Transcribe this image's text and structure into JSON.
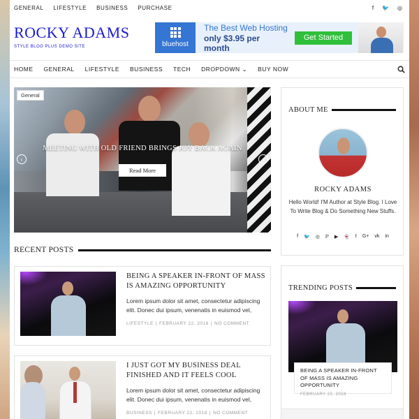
{
  "topbar": {
    "nav": [
      "GENERAL",
      "LIFESTYLE",
      "BUSINESS",
      "PURCHASE"
    ],
    "social_icons": [
      "facebook-icon",
      "twitter-icon",
      "instagram-icon"
    ]
  },
  "header": {
    "title": "ROCKY ADAMS",
    "subtitle": "STYLE BLOG PLUS DEMO SITE"
  },
  "ad": {
    "brand": "bluehost",
    "line1": "The Best Web Hosting",
    "line2": "only $3.95 per month",
    "cta": "Get Started"
  },
  "mainnav": {
    "items": [
      "HOME",
      "GENERAL",
      "LIFESTYLE",
      "BUSINESS",
      "TECH",
      "DROPDOWN",
      "BUY NOW"
    ],
    "dropdown_arrow": "⌄"
  },
  "slider": {
    "category": "General",
    "title": "MEETING WITH OLD FRIEND BRINGS JOY BACK AGAIN",
    "button": "Read More",
    "prev": "‹",
    "next": "›"
  },
  "recent": {
    "heading": "RECENT POSTS",
    "posts": [
      {
        "title": "BEING A SPEAKER IN-FRONT OF MASS IS AMAZING OPPORTUNITY",
        "excerpt": "Lorem ipsum dolor sit amet, consectetur adipiscing elit. Donec dui ipsum, venenatis in euismod vel,",
        "category": "LIFESTYLE",
        "date": "FEBRUARY 22, 2018",
        "comments": "NO COMMENT"
      },
      {
        "title": "I JUST GOT MY BUSINESS DEAL FINISHED AND IT FEELS COOL",
        "excerpt": "Lorem ipsum dolor sit amet, consectetur adipiscing elit. Donec dui ipsum, venenatis in euismod vel,",
        "category": "BUSINESS",
        "date": "FEBRUARY 22, 2018",
        "comments": "NO COMMENT"
      }
    ]
  },
  "about": {
    "heading": "ABOUT ME",
    "name": "ROCKY ADAMS",
    "bio": "Hello World! I'M Author at Style Blog. I Love To Write Blog & Do Something New Stuffs.",
    "social_icons": [
      "facebook-icon",
      "twitter-icon",
      "instagram-icon",
      "pinterest-icon",
      "youtube-icon",
      "snapchat-icon",
      "tumblr-icon",
      "google-plus-icon",
      "vk-icon",
      "linkedin-icon"
    ]
  },
  "trending": {
    "heading": "TRENDING POSTS",
    "title": "BEING A SPEAKER IN-FRONT OF MASS IS AMAZING OPPORTUNITY",
    "date": "FEBRUARY 22, 2018"
  }
}
